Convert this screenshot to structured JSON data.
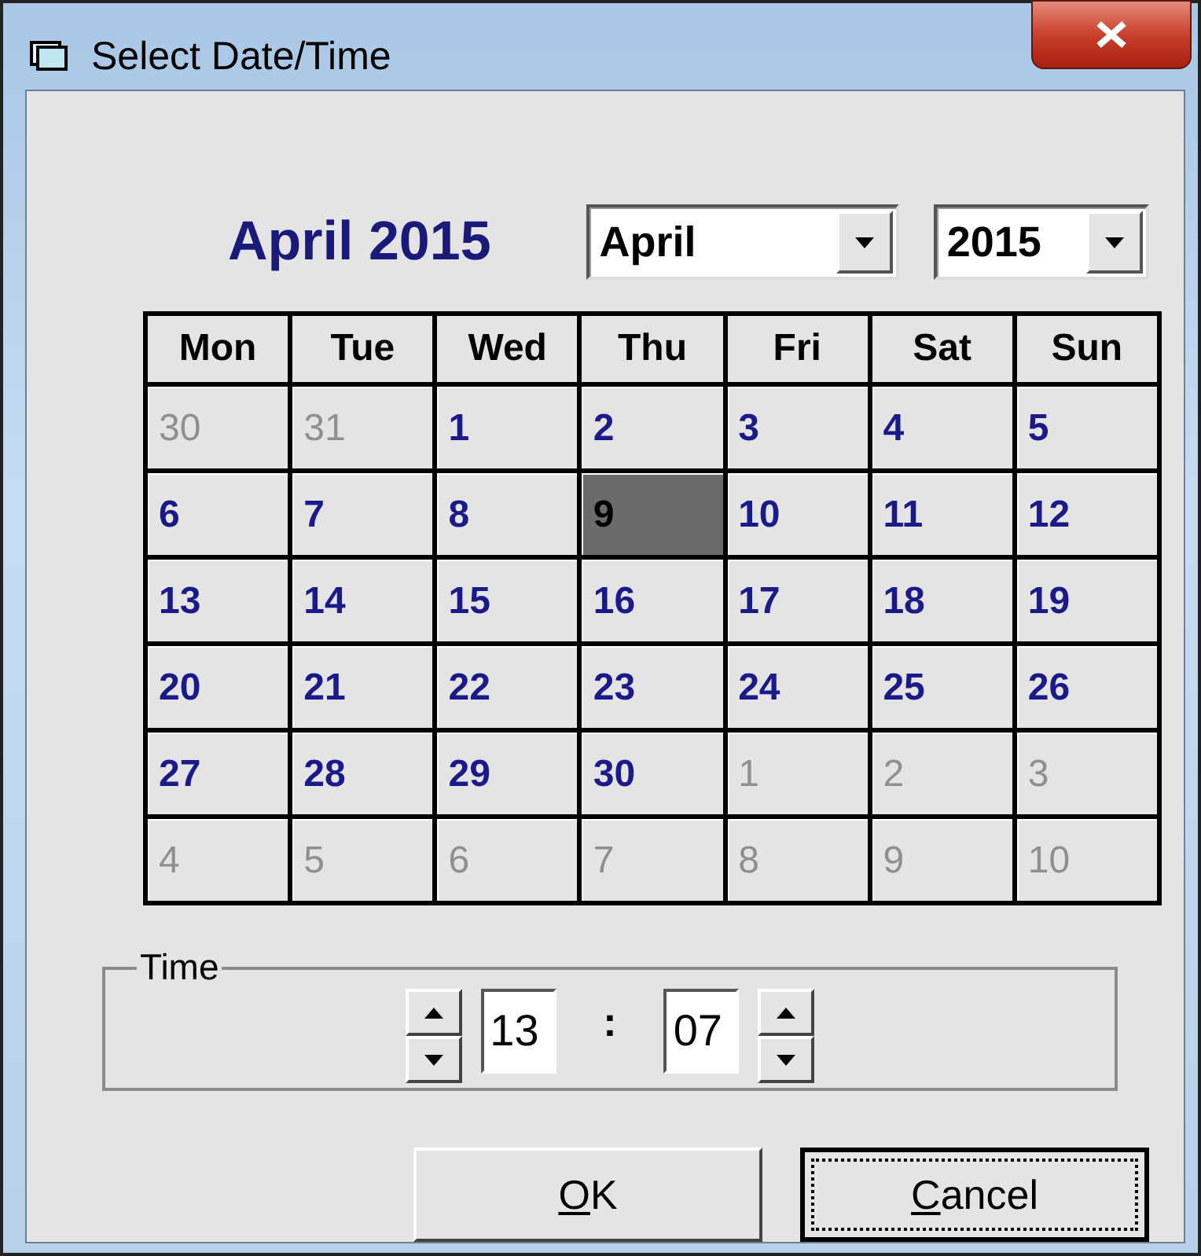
{
  "window": {
    "title": "Select Date/Time"
  },
  "calendar": {
    "heading": "April 2015",
    "month_select": "April",
    "year_select": "2015",
    "weekdays": [
      "Mon",
      "Tue",
      "Wed",
      "Thu",
      "Fri",
      "Sat",
      "Sun"
    ],
    "days": [
      {
        "label": "30",
        "in_month": false,
        "selected": false
      },
      {
        "label": "31",
        "in_month": false,
        "selected": false
      },
      {
        "label": "1",
        "in_month": true,
        "selected": false
      },
      {
        "label": "2",
        "in_month": true,
        "selected": false
      },
      {
        "label": "3",
        "in_month": true,
        "selected": false
      },
      {
        "label": "4",
        "in_month": true,
        "selected": false
      },
      {
        "label": "5",
        "in_month": true,
        "selected": false
      },
      {
        "label": "6",
        "in_month": true,
        "selected": false
      },
      {
        "label": "7",
        "in_month": true,
        "selected": false
      },
      {
        "label": "8",
        "in_month": true,
        "selected": false
      },
      {
        "label": "9",
        "in_month": true,
        "selected": true
      },
      {
        "label": "10",
        "in_month": true,
        "selected": false
      },
      {
        "label": "11",
        "in_month": true,
        "selected": false
      },
      {
        "label": "12",
        "in_month": true,
        "selected": false
      },
      {
        "label": "13",
        "in_month": true,
        "selected": false
      },
      {
        "label": "14",
        "in_month": true,
        "selected": false
      },
      {
        "label": "15",
        "in_month": true,
        "selected": false
      },
      {
        "label": "16",
        "in_month": true,
        "selected": false
      },
      {
        "label": "17",
        "in_month": true,
        "selected": false
      },
      {
        "label": "18",
        "in_month": true,
        "selected": false
      },
      {
        "label": "19",
        "in_month": true,
        "selected": false
      },
      {
        "label": "20",
        "in_month": true,
        "selected": false
      },
      {
        "label": "21",
        "in_month": true,
        "selected": false
      },
      {
        "label": "22",
        "in_month": true,
        "selected": false
      },
      {
        "label": "23",
        "in_month": true,
        "selected": false
      },
      {
        "label": "24",
        "in_month": true,
        "selected": false
      },
      {
        "label": "25",
        "in_month": true,
        "selected": false
      },
      {
        "label": "26",
        "in_month": true,
        "selected": false
      },
      {
        "label": "27",
        "in_month": true,
        "selected": false
      },
      {
        "label": "28",
        "in_month": true,
        "selected": false
      },
      {
        "label": "29",
        "in_month": true,
        "selected": false
      },
      {
        "label": "30",
        "in_month": true,
        "selected": false
      },
      {
        "label": "1",
        "in_month": false,
        "selected": false
      },
      {
        "label": "2",
        "in_month": false,
        "selected": false
      },
      {
        "label": "3",
        "in_month": false,
        "selected": false
      },
      {
        "label": "4",
        "in_month": false,
        "selected": false
      },
      {
        "label": "5",
        "in_month": false,
        "selected": false
      },
      {
        "label": "6",
        "in_month": false,
        "selected": false
      },
      {
        "label": "7",
        "in_month": false,
        "selected": false
      },
      {
        "label": "8",
        "in_month": false,
        "selected": false
      },
      {
        "label": "9",
        "in_month": false,
        "selected": false
      },
      {
        "label": "10",
        "in_month": false,
        "selected": false
      }
    ]
  },
  "time": {
    "legend": "Time",
    "hour": "13",
    "separator": ":",
    "minute": "07"
  },
  "buttons": [
    {
      "label": "OK",
      "focused": false
    },
    {
      "label": "Cancel",
      "focused": true
    }
  ]
}
